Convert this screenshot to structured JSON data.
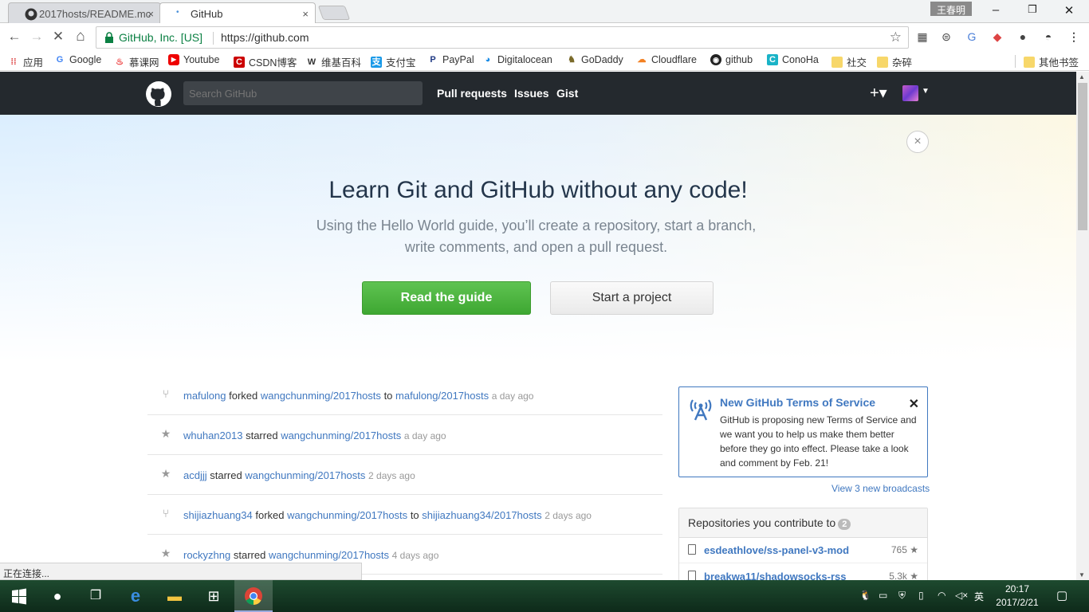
{
  "browser": {
    "tabs": [
      {
        "title": "2017hosts/README.mc",
        "close": "×"
      },
      {
        "title": "GitHub",
        "close": "×"
      }
    ],
    "user_chip": "王春明",
    "window_buttons": [
      "–",
      "❐",
      "✕"
    ],
    "nav": {
      "back": "←",
      "forward": "→",
      "stop": "✕",
      "home": "⌂"
    },
    "omnibox": {
      "site_name": "GitHub, Inc. [US]",
      "url": "https://github.com",
      "star": "☆"
    },
    "bookmarks": [
      {
        "label": "应用",
        "icon": "apps-icon"
      },
      {
        "label": "Google",
        "icon": "google-icon"
      },
      {
        "label": "慕课网",
        "icon": "flame-icon"
      },
      {
        "label": "Youtube",
        "icon": "youtube-icon"
      },
      {
        "label": "CSDN博客",
        "icon": "csdn-icon"
      },
      {
        "label": "维基百科",
        "icon": "wikipedia-icon"
      },
      {
        "label": "支付宝",
        "icon": "alipay-icon"
      },
      {
        "label": "PayPal",
        "icon": "paypal-icon"
      },
      {
        "label": "Digitalocean",
        "icon": "digitalocean-icon"
      },
      {
        "label": "GoDaddy",
        "icon": "godaddy-icon"
      },
      {
        "label": "Cloudflare",
        "icon": "cloud-icon"
      },
      {
        "label": "github",
        "icon": "github-icon"
      },
      {
        "label": "ConoHa",
        "icon": "conoha-icon"
      },
      {
        "label": "社交",
        "icon": "folder-icon"
      },
      {
        "label": "杂碎",
        "icon": "folder-icon"
      },
      {
        "label": "其他书签",
        "icon": "folder-icon"
      }
    ],
    "status_text": "正在连接..."
  },
  "github": {
    "search_placeholder": "Search GitHub",
    "nav": [
      "Pull requests",
      "Issues",
      "Gist"
    ],
    "plus": "+▾",
    "hero": {
      "title": "Learn Git and GitHub without any code!",
      "subtitle": "Using the Hello World guide, you’ll create a repository, start a branch, write comments, and open a pull request.",
      "primary_button": "Read the guide",
      "secondary_button": "Start a project",
      "close": "×"
    },
    "feed": [
      {
        "type": "fork",
        "user": "mafulong",
        "verb": "forked",
        "repo": "wangchunming/2017hosts",
        "to": "to",
        "target": "mafulong/2017hosts",
        "ago": "a day ago"
      },
      {
        "type": "star",
        "user": "whuhan2013",
        "verb": "starred",
        "repo": "wangchunming/2017hosts",
        "ago": "a day ago"
      },
      {
        "type": "star",
        "user": "acdjjj",
        "verb": "starred",
        "repo": "wangchunming/2017hosts",
        "ago": "2 days ago"
      },
      {
        "type": "fork",
        "user": "shijiazhuang34",
        "verb": "forked",
        "repo": "wangchunming/2017hosts",
        "to": "to",
        "target": "shijiazhuang34/2017hosts",
        "ago": "2 days ago"
      },
      {
        "type": "star",
        "user": "rockyzhng",
        "verb": "starred",
        "repo": "wangchunming/2017hosts",
        "ago": "4 days ago"
      }
    ],
    "broadcast": {
      "title": "New GitHub Terms of Service",
      "body": "GitHub is proposing new Terms of Service and we want you to help us make them better before they go into effect. Please take a look and comment by Feb. 21!",
      "close": "✕",
      "more": "View 3 new broadcasts"
    },
    "repos": {
      "title": "Repositories you contribute to",
      "count": "2",
      "items": [
        {
          "name": "esdeathlove/ss-panel-v3-mod",
          "stars": "765 ★"
        },
        {
          "name": "breakwa11/shadowsocks-rss",
          "stars": "5.3k ★"
        }
      ]
    }
  },
  "taskbar": {
    "clock_time": "20:17",
    "clock_date": "2017/2/21",
    "ime": "英"
  }
}
